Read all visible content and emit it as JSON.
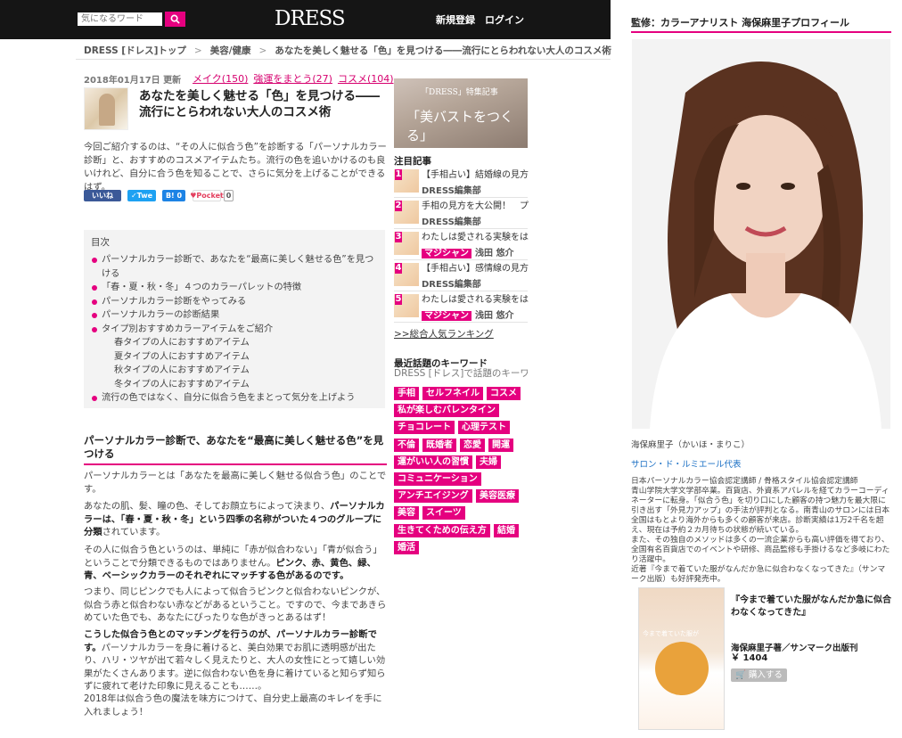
{
  "header": {
    "search_placeholder": "気になるワード",
    "logo": "DRESS",
    "signup": "新規登録",
    "login": "ログイン"
  },
  "breadcrumb": [
    "DRESS [ドレス]トップ",
    "美容/健康",
    "あなたを美しく魅せる「色」を見つける――流行にとらわれない大人のコスメ術"
  ],
  "article": {
    "date": "2018年01月17日 更新",
    "tags": [
      "メイク(150)",
      "強運をまとう(27)",
      "コスメ(104)"
    ],
    "title": "あなたを美しく魅せる「色」を見つける――流行にとらわれない大人のコスメ術",
    "intro": "今回ご紹介するのは、“その人に似合う色”を診断する「パーソナルカラー診断」と、おすすめのコスメアイテムたち。流行の色を追いかけるのも良いけれど、自分に合う色を知ることで、さらに気分を上げることができるはず。",
    "share": {
      "like": "いいね",
      "tweet": "Twe",
      "hatena": "0",
      "pocket": "Pocket",
      "pocket_count": "0"
    },
    "toc_title": "目次",
    "toc": [
      {
        "text": "パーソナルカラー診断で、あなたを“最高に美しく魅せる色”を見つける",
        "level": 1
      },
      {
        "text": "「春・夏・秋・冬」４つのカラーパレットの特徴",
        "level": 1
      },
      {
        "text": "パーソナルカラー診断をやってみる",
        "level": 1
      },
      {
        "text": "パーソナルカラーの診断結果",
        "level": 1
      },
      {
        "text": "タイプ別おすすめカラーアイテムをご紹介",
        "level": 1
      },
      {
        "text": "春タイプの人におすすめアイテム",
        "level": 2
      },
      {
        "text": "夏タイプの人におすすめアイテム",
        "level": 2
      },
      {
        "text": "秋タイプの人におすすめアイテム",
        "level": 2
      },
      {
        "text": "冬タイプの人におすすめアイテム",
        "level": 2
      },
      {
        "text": "流行の色ではなく、自分に似合う色をまとって気分を上げよう",
        "level": 1
      }
    ],
    "h2": "パーソナルカラー診断で、あなたを“最高に美しく魅せる色”を見つける",
    "p1": "パーソナルカラーとは「あなたを最高に美しく魅せる似合う色」のことです。",
    "p2a": "あなたの肌、髪、瞳の色、そしてお顔立ちによって決まり、",
    "p2b": "パーソナルカラーは、「春・夏・秋・冬」という四季の名称がついた４つのグループに分類",
    "p2c": "されています。",
    "p3a": "その人に似合う色というのは、単純に「赤が似合わない」「青が似合う」ということで分類できるものではありません。",
    "p3b": "ピンク、赤、黄色、緑、青、ベーシックカラーのそれぞれにマッチする色があるのです。",
    "p4": "つまり、同じピンクでも人によって似合うピンクと似合わないピンクが、似合う赤と似合わない赤などがあるということ。ですので、今まであきらめていた色でも、あなたにぴったりな色がきっとあるはず！",
    "p5a": "こうした似合う色とのマッチングを行うのが、パーソナルカラー診断です。",
    "p5b": "パーソナルカラーを身に着けると、美白効果でお肌に透明感が出たり、ハリ・ツヤが出て若々しく見えたりと、大人の女性にとって嬉しい効果がたくさんあります。逆に似合わない色を身に着けていると知らず知らずに疲れて老けた印象に見えることも……。",
    "p6": "2018年は似合う色の魔法を味方につけて、自分史上最高のキレイを手に入れましょう！"
  },
  "middle": {
    "banner_label": "「DRESS」特集記事",
    "banner_title": "「美バストをつくる」",
    "featured_head": "注目記事",
    "ranking": [
      {
        "num": "1",
        "title": "【手相占い】結婚線の見方",
        "author": "DRESS編集部",
        "badge": ""
      },
      {
        "num": "2",
        "title": "手相の見方を大公開！　プ",
        "author": "DRESS編集部",
        "badge": ""
      },
      {
        "num": "3",
        "title": "わたしは愛される実験をは",
        "author": "浅田 悠介",
        "badge": "マジシャン"
      },
      {
        "num": "4",
        "title": "【手相占い】感情線の見方",
        "author": "DRESS編集部",
        "badge": ""
      },
      {
        "num": "5",
        "title": "わたしは愛される実験をは",
        "author": "浅田 悠介",
        "badge": "マジシャン"
      }
    ],
    "ranking_link": ">>総合人気ランキング",
    "kw_head": "最近話題のキーワード",
    "kw_sub": "DRESS [ドレス]で話題のキーワ",
    "keywords": [
      "手相",
      "セルフネイル",
      "コスメ",
      "私が楽しむバレンタイン",
      "チョコレート",
      "心理テスト",
      "不倫",
      "既婚者",
      "恋愛",
      "開運",
      "運がいい人の習慣",
      "夫婦",
      "コミュニケーション",
      "アンチエイジング",
      "美容医療",
      "美容",
      "スイーツ",
      "生きてくための伝え方",
      "結婚",
      "婚活"
    ]
  },
  "right": {
    "supervisor": "監修：カラーアナリスト 海保麻里子プロフィール",
    "name": "海保麻里子（かいほ・まりこ）",
    "shop": "サロン・ド・ルミエール代表",
    "bio": "日本パーソナルカラー協会認定講師 / 骨格スタイル協会認定講師\n青山学院大学文学部卒業。百貨店、外資系アパレルを経てカラーコーディネーターに転身。「似合う色」を切り口にした顧客の持つ魅力を最大限に引き出す「外見力アップ」の手法が評判となる。南青山のサロンには日本全国はもとより海外からも多くの顧客が来店。診断実績は1万2千名を超え、現在は予約２カ月待ちの状態が続いている。\nまた、その独自のメソッドは多くの一流企業からも高い評価を得ており、全国有名百貨店でのイベントや研修、商品監修も手掛けるなど多岐にわたり活躍中。\n近著『今まで着ていた服がなんだか急に似合わなくなってきた』（サンマーク出版）も好評発売中。",
    "book_title": "『今まで着ていた服がなんだか急に似合わなくなってきた』",
    "book_author": "海保麻里子著／サンマーク出版刊",
    "book_price": "￥ 1404",
    "buy": "購入する",
    "cover_text": "今まで着ていた服が"
  },
  "colors": {
    "accent": "#e5007f",
    "header_bg": "#151515",
    "link_blue": "#1a6fc4"
  }
}
